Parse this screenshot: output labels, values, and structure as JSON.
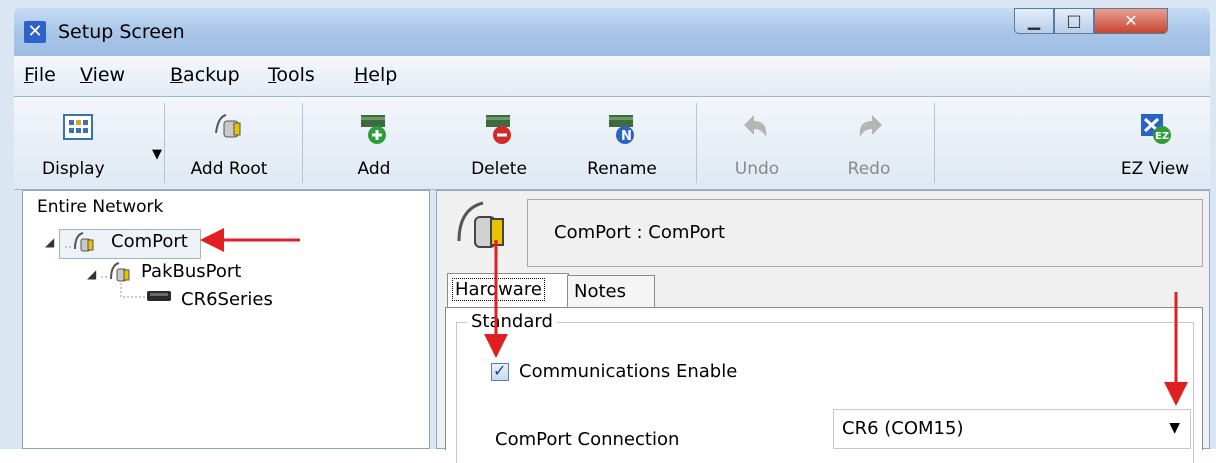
{
  "window": {
    "title": "Setup Screen"
  },
  "menu": [
    {
      "label": "File",
      "mnemonic": "F"
    },
    {
      "label": "View",
      "mnemonic": "V"
    },
    {
      "label": "Backup",
      "mnemonic": "B"
    },
    {
      "label": "Tools",
      "mnemonic": "T"
    },
    {
      "label": "Help",
      "mnemonic": "H"
    }
  ],
  "toolbar": {
    "display": "Display",
    "add_root": "Add Root",
    "add": "Add",
    "delete": "Delete",
    "rename": "Rename",
    "undo": "Undo",
    "redo": "Redo",
    "ez_view": "EZ View"
  },
  "tree": {
    "header": "Entire Network",
    "nodes": [
      "ComPort",
      "PakBusPort",
      "CR6Series"
    ]
  },
  "detail": {
    "header": "ComPort : ComPort",
    "tabs": [
      "Hardware",
      "Notes"
    ],
    "group_title": "Standard",
    "comm_enabled_label": "Communications Enable",
    "comm_enabled": true,
    "comport_label": "ComPort Connection",
    "comport_value": "CR6 (COM15)"
  },
  "colors": {
    "annotation_arrow": "#e02020",
    "accent": "#2d63c8"
  }
}
